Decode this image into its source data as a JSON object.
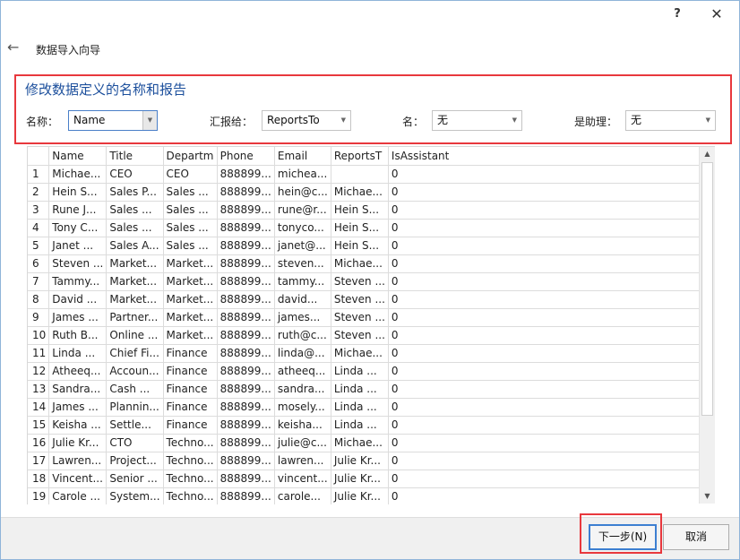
{
  "window": {
    "help_label": "?",
    "close_label": "✕"
  },
  "wizard": {
    "back_label": "←",
    "title": "数据导入向导"
  },
  "definition": {
    "title": "修改数据定义的名称和报告",
    "name_label": "名称：",
    "name_value": "Name",
    "reports_label": "汇报给：",
    "reports_value": "ReportsTo",
    "given_label": "名：",
    "given_value": "无",
    "assistant_label": "是助理：",
    "assistant_value": "无"
  },
  "grid": {
    "columns": [
      "",
      "Name",
      "Title",
      "Departm",
      "Phone",
      "Email",
      "ReportsT",
      "IsAssistant"
    ],
    "rows": [
      [
        "1",
        "Michae...",
        "CEO",
        "CEO",
        "888899...",
        "michea...",
        "",
        "0"
      ],
      [
        "2",
        "Hein S...",
        "Sales P...",
        "Sales ...",
        "888899...",
        "hein@c...",
        "Michae...",
        "0"
      ],
      [
        "3",
        "Rune J...",
        "Sales ...",
        "Sales ...",
        "888899...",
        "rune@r...",
        "Hein S...",
        "0"
      ],
      [
        "4",
        "Tony C...",
        "Sales ...",
        "Sales ...",
        "888899...",
        "tonyco...",
        "Hein S...",
        "0"
      ],
      [
        "5",
        "Janet ...",
        "Sales A...",
        "Sales ...",
        "888899...",
        "janet@...",
        "Hein S...",
        "0"
      ],
      [
        "6",
        "Steven ...",
        "Market...",
        "Market...",
        "888899...",
        "steven...",
        "Michae...",
        "0"
      ],
      [
        "7",
        "Tammy...",
        "Market...",
        "Market...",
        "888899...",
        "tammy...",
        "Steven ...",
        "0"
      ],
      [
        "8",
        "David ...",
        "Market...",
        "Market...",
        "888899...",
        "david...",
        "Steven ...",
        "0"
      ],
      [
        "9",
        "James ...",
        "Partner...",
        "Market...",
        "888899...",
        "james...",
        "Steven ...",
        "0"
      ],
      [
        "10",
        "Ruth B...",
        "Online ...",
        "Market...",
        "888899...",
        "ruth@c...",
        "Steven ...",
        "0"
      ],
      [
        "11",
        "Linda ...",
        "Chief Fi...",
        "Finance",
        "888899...",
        "linda@...",
        "Michae...",
        "0"
      ],
      [
        "12",
        "Atheeq...",
        "Accoun...",
        "Finance",
        "888899...",
        "atheeq...",
        "Linda ...",
        "0"
      ],
      [
        "13",
        "Sandra...",
        "Cash ...",
        "Finance",
        "888899...",
        "sandra...",
        "Linda ...",
        "0"
      ],
      [
        "14",
        "James ...",
        "Plannin...",
        "Finance",
        "888899...",
        "mosely...",
        "Linda ...",
        "0"
      ],
      [
        "15",
        "Keisha ...",
        "Settle...",
        "Finance",
        "888899...",
        "keisha...",
        "Linda ...",
        "0"
      ],
      [
        "16",
        "Julie Kr...",
        "CTO",
        "Techno...",
        "888899...",
        "julie@c...",
        "Michae...",
        "0"
      ],
      [
        "17",
        "Lawren...",
        "Project...",
        "Techno...",
        "888899...",
        "lawren...",
        "Julie Kr...",
        "0"
      ],
      [
        "18",
        "Vincent...",
        "Senior ...",
        "Techno...",
        "888899...",
        "vincent...",
        "Julie Kr...",
        "0"
      ],
      [
        "19",
        "Carole ...",
        "System...",
        "Techno...",
        "888899...",
        "carole...",
        "Julie Kr...",
        "0"
      ]
    ]
  },
  "buttons": {
    "next_label": "下一步(N)",
    "cancel_label": "取消"
  },
  "colors": {
    "highlight": "#e8383d",
    "section_title": "#1c4f9c",
    "primary_border": "#3c7fd1"
  }
}
